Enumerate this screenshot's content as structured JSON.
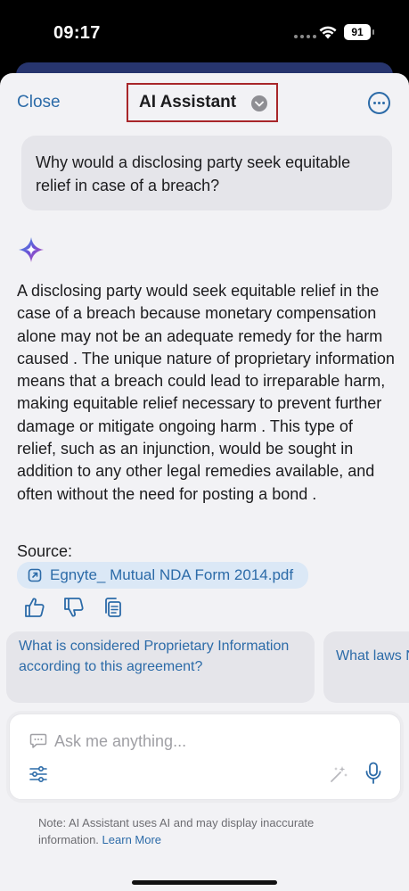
{
  "status_bar": {
    "time": "09:17",
    "battery": "91"
  },
  "header": {
    "close_label": "Close",
    "title": "AI Assistant"
  },
  "conversation": {
    "user_question": "Why would a disclosing party seek equitable relief in case of a breach?",
    "ai_answer": "A disclosing party would seek equitable relief in the case of a breach because monetary compensation alone may not be an adequate remedy for the harm caused . The unique nature of proprietary information means that a breach could lead to irreparable harm, making equitable relief necessary to prevent further damage or mitigate ongoing harm . This type of relief, such as an injunction, would be sought in addition to any other legal remedies available, and often without the need for posting a bond .",
    "source_label": "Source:",
    "source_file": "Egnyte_ Mutual NDA Form 2014.pdf"
  },
  "suggestions": [
    "What is considered Proprietary Information according to this agreement?",
    "What laws Nondisclos"
  ],
  "input": {
    "placeholder": "Ask me anything..."
  },
  "footer": {
    "note": "Note: AI Assistant uses AI and may display inaccurate information.",
    "learn_more": "Learn More"
  },
  "colors": {
    "accent": "#2c6ba8",
    "highlight_border": "#a8262a",
    "sheet_background": "#f2f2f5",
    "bubble_background": "#e5e5ea"
  }
}
